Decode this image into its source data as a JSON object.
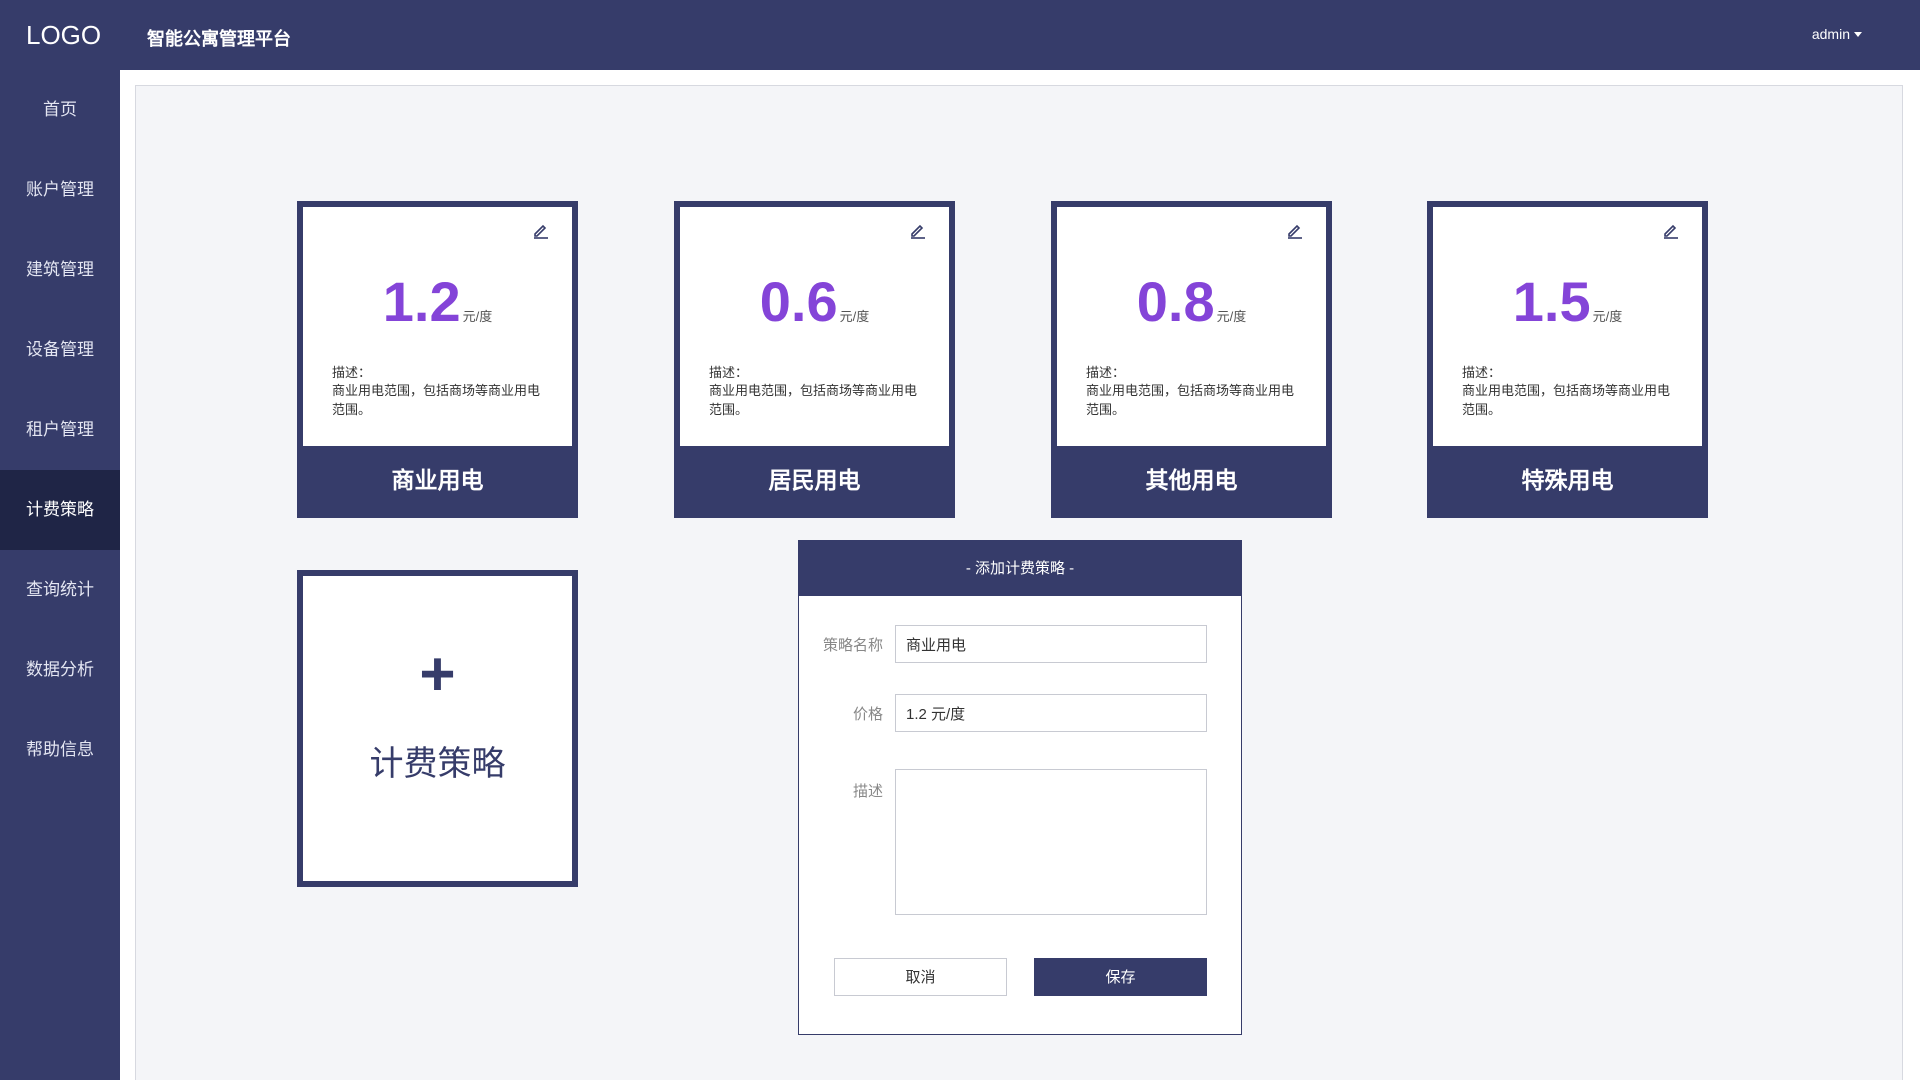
{
  "header": {
    "logo": "LOGO",
    "platform_title": "智能公寓管理平台",
    "user": "admin"
  },
  "sidebar": {
    "items": [
      {
        "label": "首页"
      },
      {
        "label": "账户管理"
      },
      {
        "label": "建筑管理"
      },
      {
        "label": "设备管理"
      },
      {
        "label": "租户管理"
      },
      {
        "label": "计费策略",
        "active": true
      },
      {
        "label": "查询统计"
      },
      {
        "label": "数据分析"
      },
      {
        "label": "帮助信息"
      }
    ]
  },
  "strategies": [
    {
      "price": "1.2",
      "unit": "元/度",
      "desc_label": "描述：",
      "desc": "商业用电范围，包括商场等商业用电范围。",
      "name": "商业用电"
    },
    {
      "price": "0.6",
      "unit": "元/度",
      "desc_label": "描述：",
      "desc": "商业用电范围，包括商场等商业用电范围。",
      "name": "居民用电"
    },
    {
      "price": "0.8",
      "unit": "元/度",
      "desc_label": "描述：",
      "desc": "商业用电范围，包括商场等商业用电范围。",
      "name": "其他用电"
    },
    {
      "price": "1.5",
      "unit": "元/度",
      "desc_label": "描述：",
      "desc": "商业用电范围，包括商场等商业用电范围。",
      "name": "特殊用电"
    }
  ],
  "add_card": {
    "plus": "+",
    "label": "计费策略"
  },
  "modal": {
    "title": "- 添加计费策略 -",
    "name_label": "策略名称",
    "name_value": "商业用电",
    "price_label": "价格",
    "price_value": "1.2 元/度",
    "desc_label": "描述",
    "desc_value": "",
    "cancel": "取消",
    "save": "保存"
  },
  "colors": {
    "primary": "#363c6a",
    "sidebar_active": "#1f2546",
    "price": "#8444d8",
    "content_bg": "#f4f5f8"
  },
  "icons": [
    "edit-icon",
    "caret-down-icon",
    "plus-icon"
  ]
}
